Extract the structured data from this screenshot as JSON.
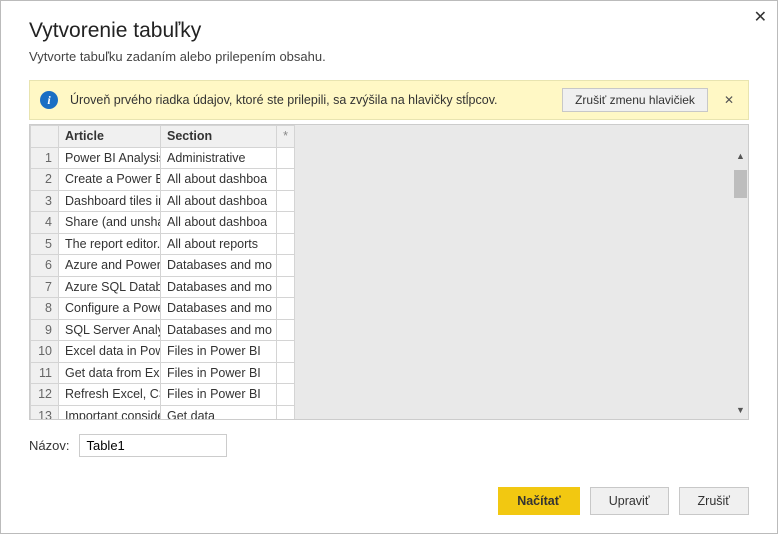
{
  "dialog": {
    "title": "Vytvorenie tabuľky",
    "subtitle": "Vytvorte tabuľku zadaním alebo prilepením obsahu."
  },
  "info": {
    "message": "Úroveň prvého riadka údajov, ktoré ste prilepili, sa zvýšila na hlavičky stĺpcov.",
    "undo_label": "Zrušiť zmenu hlavičiek"
  },
  "table": {
    "headers": {
      "c1": "Article",
      "c2": "Section",
      "star": "*"
    },
    "rows": [
      {
        "n": "1",
        "article": "Power BI Analysis",
        "section": "Administrative"
      },
      {
        "n": "2",
        "article": "Create a Power BI",
        "section": "All about dashboa"
      },
      {
        "n": "3",
        "article": "Dashboard tiles in",
        "section": "All about dashboa"
      },
      {
        "n": "4",
        "article": "Share (and unshar",
        "section": "All about dashboa"
      },
      {
        "n": "5",
        "article": "The report editor..",
        "section": "All about reports"
      },
      {
        "n": "6",
        "article": "Azure and Power B",
        "section": "Databases and mo"
      },
      {
        "n": "7",
        "article": "Azure SQL Databa",
        "section": "Databases and mo"
      },
      {
        "n": "8",
        "article": "Configure a Power",
        "section": "Databases and mo"
      },
      {
        "n": "9",
        "article": "SQL Server Analys",
        "section": "Databases and mo"
      },
      {
        "n": "10",
        "article": "Excel data in Powe",
        "section": "Files in Power BI"
      },
      {
        "n": "11",
        "article": "Get data from Exce",
        "section": "Files in Power BI"
      },
      {
        "n": "12",
        "article": "Refresh Excel, CSV",
        "section": "Files in Power BI"
      },
      {
        "n": "13",
        "article": "Important conside",
        "section": "Get data"
      }
    ]
  },
  "name": {
    "label": "Názov:",
    "value": "Table1"
  },
  "footer": {
    "load": "Načítať",
    "edit": "Upraviť",
    "cancel": "Zrušiť"
  }
}
